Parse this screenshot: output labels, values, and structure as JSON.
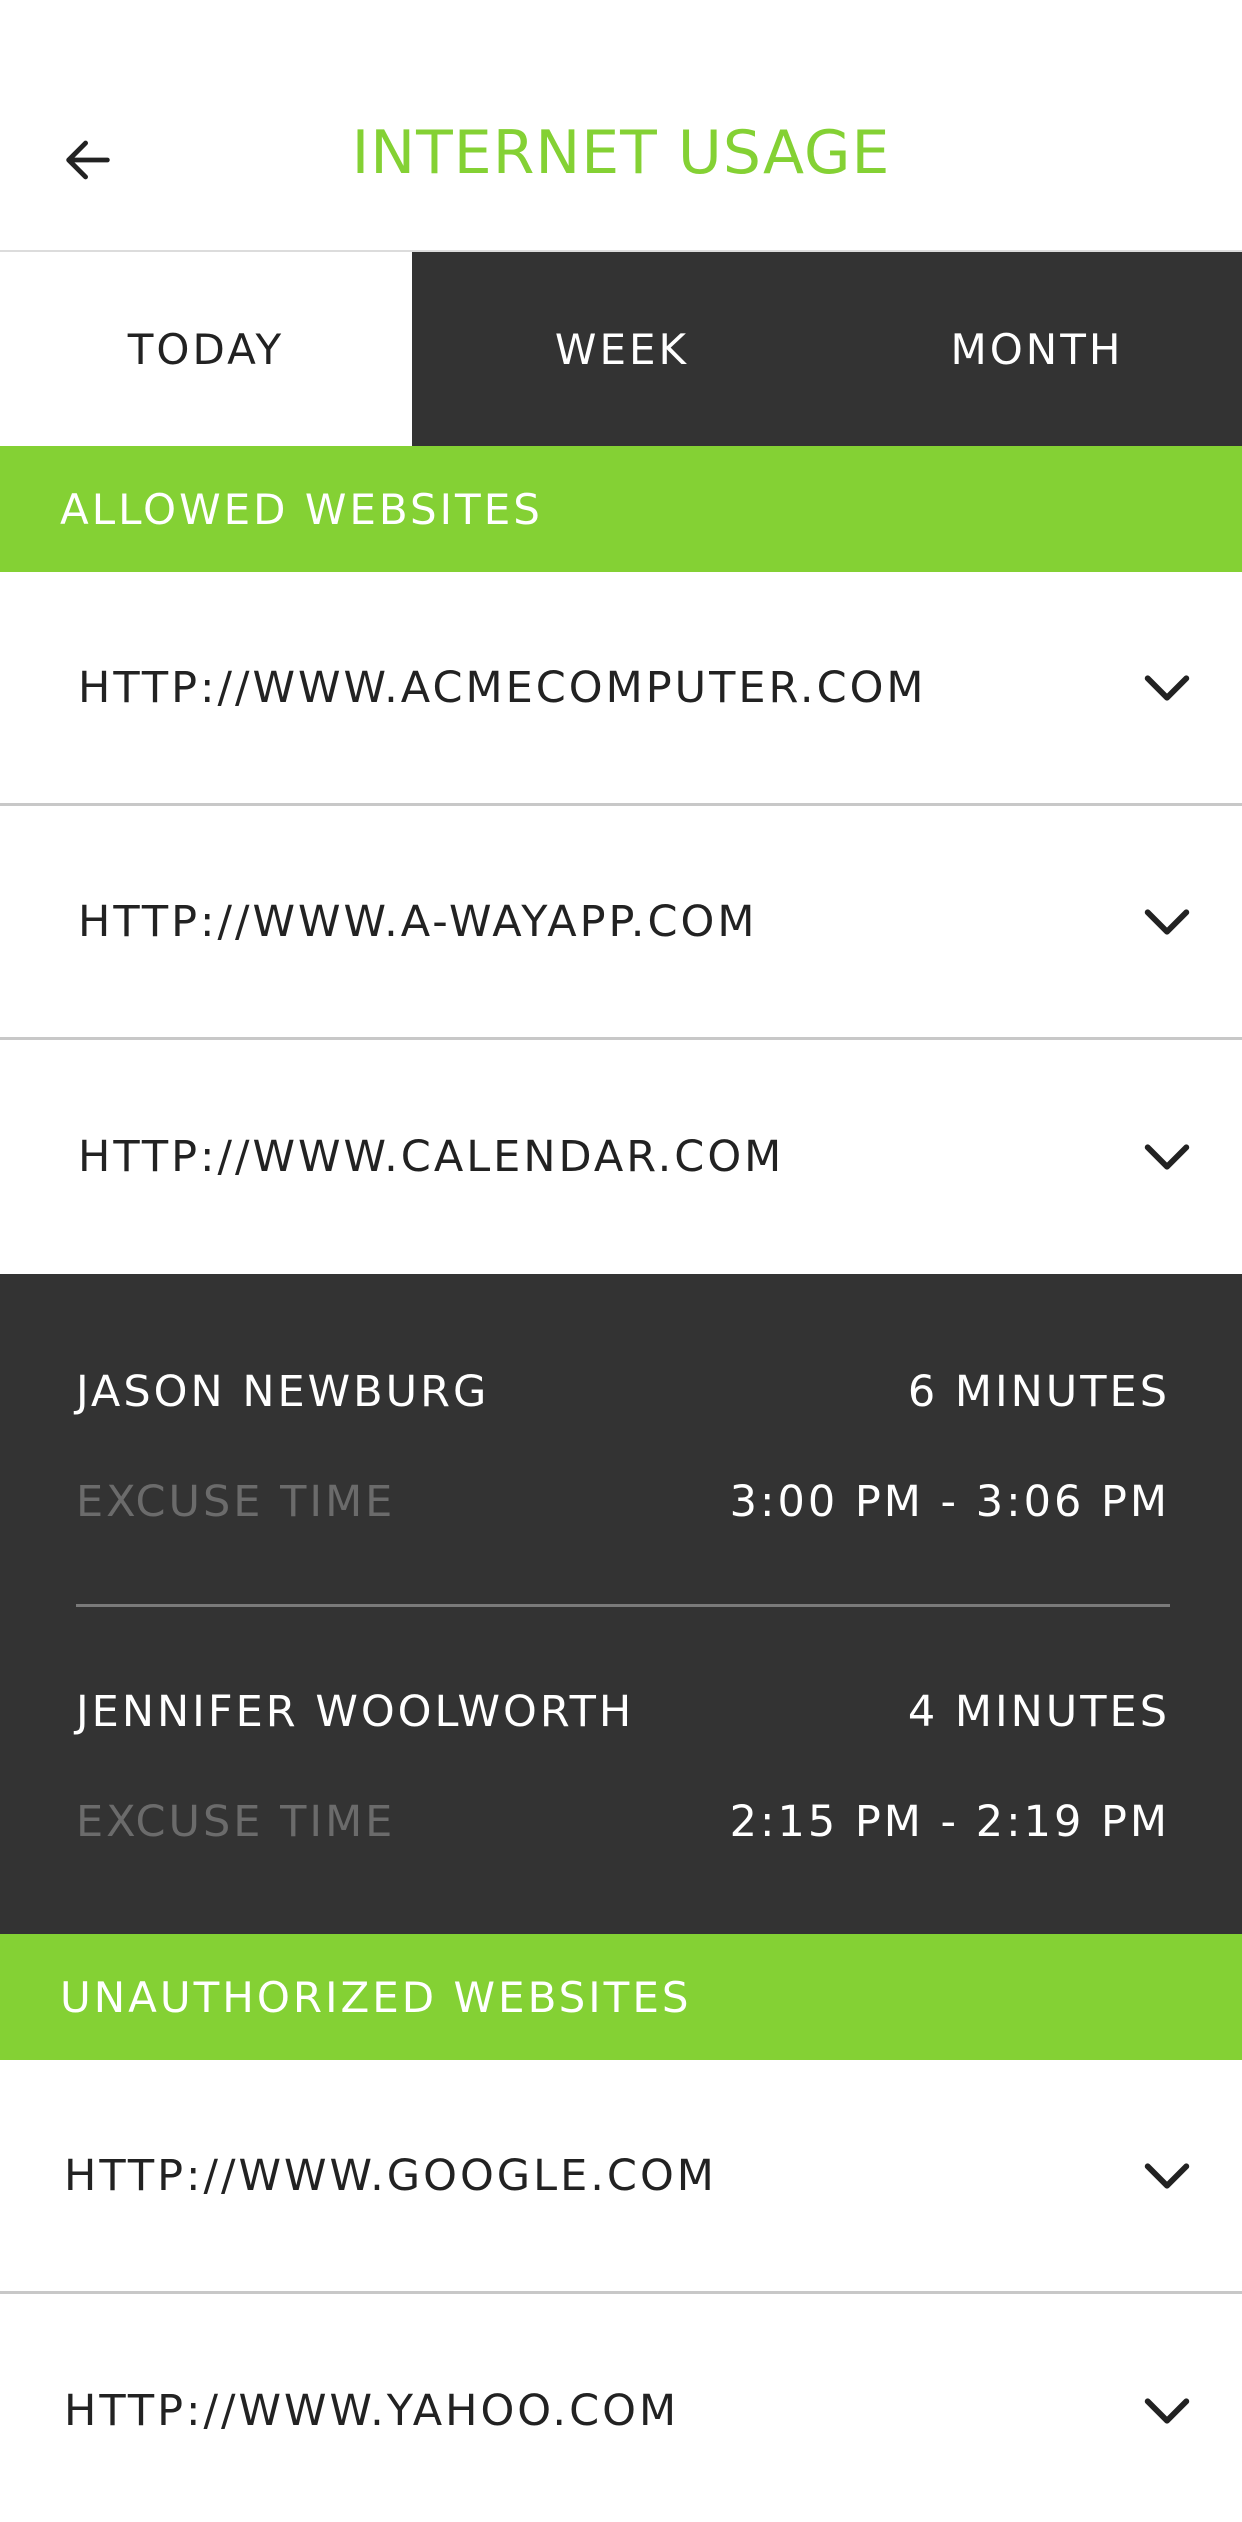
{
  "header": {
    "title": "INTERNET USAGE",
    "back_icon": "arrow-left-icon"
  },
  "tabs": [
    {
      "label": "TODAY",
      "active": true
    },
    {
      "label": "WEEK",
      "active": false
    },
    {
      "label": "MONTH",
      "active": false
    }
  ],
  "allowed": {
    "title": "ALLOWED WEBSITES",
    "items": [
      {
        "url": "HTTP://WWW.ACMECOMPUTER.COM"
      },
      {
        "url": "HTTP://WWW.A-WAYAPP.COM"
      },
      {
        "url": "HTTP://WWW.CALENDAR.COM"
      }
    ]
  },
  "details": [
    {
      "name": "JASON NEWBURG",
      "duration": "6 MINUTES",
      "excuse_label": "EXCUSE TIME",
      "range": "3:00 PM - 3:06 PM"
    },
    {
      "name": "JENNIFER WOOLWORTH",
      "duration": "4 MINUTES",
      "excuse_label": "EXCUSE TIME",
      "range": "2:15 PM - 2:19 PM"
    }
  ],
  "unauthorized": {
    "title": "UNAUTHORIZED WEBSITES",
    "items": [
      {
        "url": "HTTP://WWW.GOOGLE.COM"
      },
      {
        "url": "HTTP://WWW.YAHOO.COM"
      }
    ]
  },
  "colors": {
    "accent": "#84d134",
    "dark": "#333333"
  }
}
